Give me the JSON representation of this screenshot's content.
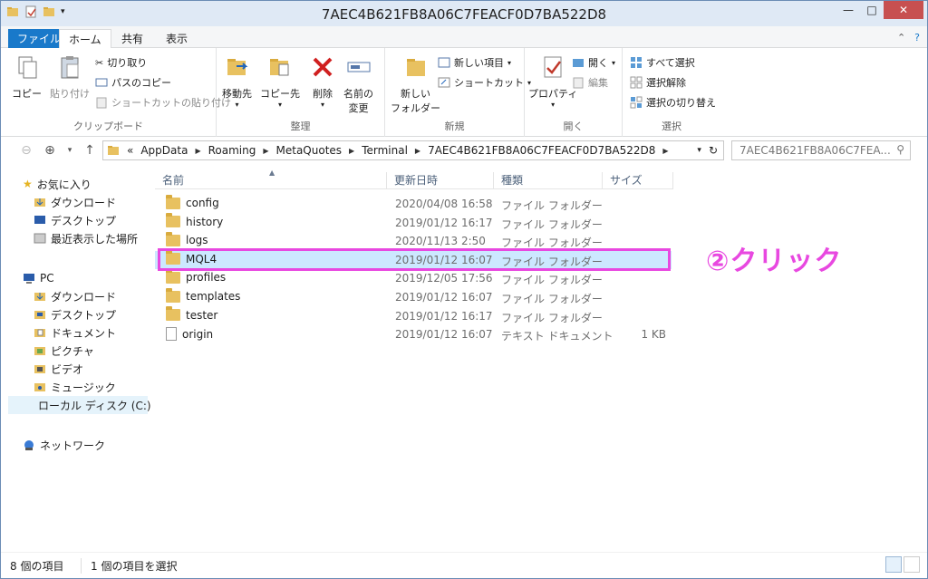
{
  "window": {
    "title": "7AEC4B621FB8A06C7FEACF0D7BA522D8",
    "controls": {
      "minimize": "—",
      "maximize": "□",
      "close": "✕"
    }
  },
  "ribbon_tabs": {
    "file": "ファイル",
    "home": "ホーム",
    "share": "共有",
    "view": "表示"
  },
  "ribbon": {
    "clipboard": {
      "label": "クリップボード",
      "copy": "コピー",
      "paste": "貼り付け",
      "cut": "切り取り",
      "copy_path": "パスのコピー",
      "paste_shortcut": "ショートカットの貼り付け"
    },
    "organize": {
      "label": "整理",
      "move_to": "移動先",
      "copy_to": "コピー先",
      "delete": "削除",
      "rename_line1": "名前の",
      "rename_line2": "変更"
    },
    "new": {
      "label": "新規",
      "new_folder_line1": "新しい",
      "new_folder_line2": "フォルダー",
      "new_item": "新しい項目",
      "shortcut": "ショートカット"
    },
    "open": {
      "label": "開く",
      "properties": "プロパティ",
      "open": "開く",
      "edit": "編集"
    },
    "select": {
      "label": "選択",
      "select_all": "すべて選択",
      "select_none": "選択解除",
      "invert": "選択の切り替え"
    }
  },
  "address": {
    "crumbs": [
      "«",
      "AppData",
      "Roaming",
      "MetaQuotes",
      "Terminal",
      "7AEC4B621FB8A06C7FEACF0D7BA522D8"
    ],
    "search_placeholder": "7AEC4B621FB8A06C7FEA..."
  },
  "nav": {
    "favorites": "お気に入り",
    "fav_items": [
      "ダウンロード",
      "デスクトップ",
      "最近表示した場所"
    ],
    "pc": "PC",
    "pc_items": [
      "ダウンロード",
      "デスクトップ",
      "ドキュメント",
      "ピクチャ",
      "ビデオ",
      "ミュージック",
      "ローカル ディスク (C:)"
    ],
    "network": "ネットワーク"
  },
  "columns": {
    "name": "名前",
    "date": "更新日時",
    "type": "種類",
    "size": "サイズ"
  },
  "files": [
    {
      "name": "config",
      "date": "2020/04/08 16:58",
      "type": "ファイル フォルダー",
      "size": "",
      "kind": "folder"
    },
    {
      "name": "history",
      "date": "2019/01/12 16:17",
      "type": "ファイル フォルダー",
      "size": "",
      "kind": "folder"
    },
    {
      "name": "logs",
      "date": "2020/11/13 2:50",
      "type": "ファイル フォルダー",
      "size": "",
      "kind": "folder"
    },
    {
      "name": "MQL4",
      "date": "2019/01/12 16:07",
      "type": "ファイル フォルダー",
      "size": "",
      "kind": "folder",
      "selected": true
    },
    {
      "name": "profiles",
      "date": "2019/12/05 17:56",
      "type": "ファイル フォルダー",
      "size": "",
      "kind": "folder"
    },
    {
      "name": "templates",
      "date": "2019/01/12 16:07",
      "type": "ファイル フォルダー",
      "size": "",
      "kind": "folder"
    },
    {
      "name": "tester",
      "date": "2019/01/12 16:17",
      "type": "ファイル フォルダー",
      "size": "",
      "kind": "folder"
    },
    {
      "name": "origin",
      "date": "2019/01/12 16:07",
      "type": "テキスト ドキュメント",
      "size": "1 KB",
      "kind": "file"
    }
  ],
  "annotation": "②クリック",
  "status": {
    "item_count": "8 個の項目",
    "selected_count": "1 個の項目を選択"
  },
  "colors": {
    "accent": "#1979ca",
    "selection": "#cce8ff",
    "annotation": "#e848e0",
    "folder": "#e8c160"
  }
}
